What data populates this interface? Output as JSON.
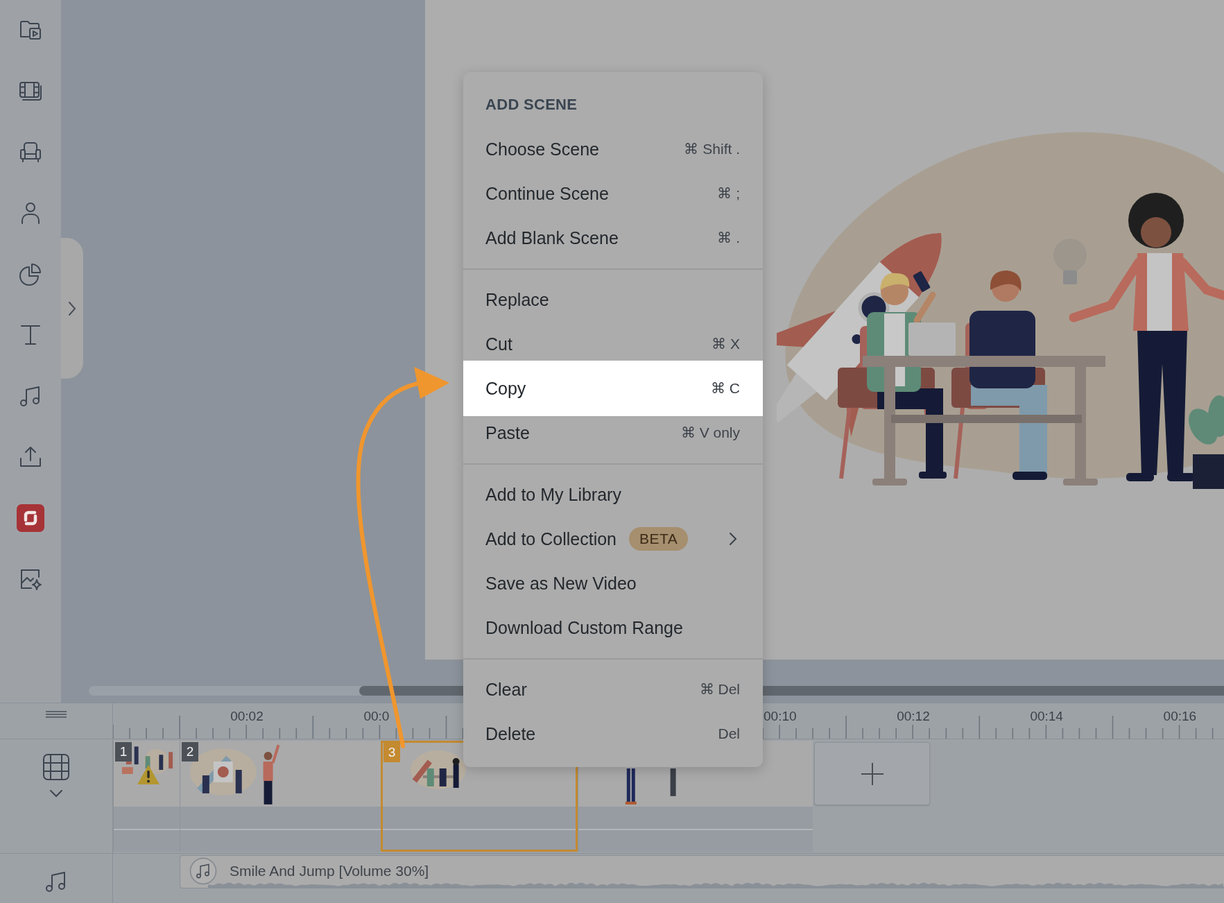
{
  "context_menu": {
    "sections": [
      {
        "header": "ADD SCENE",
        "items": [
          {
            "label": "Choose Scene",
            "shortcut": "⌘ Shift .",
            "submenu": false,
            "selected": false
          },
          {
            "label": "Continue Scene",
            "shortcut": "⌘ ;",
            "submenu": false,
            "selected": false
          },
          {
            "label": "Add Blank Scene",
            "shortcut": "⌘ .",
            "submenu": false,
            "selected": false
          }
        ]
      },
      {
        "items": [
          {
            "label": "Replace",
            "submenu": false,
            "selected": false
          },
          {
            "label": "Cut",
            "shortcut": "⌘ X",
            "submenu": false,
            "selected": false
          },
          {
            "label": "Copy",
            "shortcut": "⌘ C",
            "submenu": false,
            "selected": true
          },
          {
            "label": "Paste",
            "shortcut": "⌘ V only",
            "submenu": false,
            "selected": false
          }
        ]
      },
      {
        "items": [
          {
            "label": "Add to My Library",
            "submenu": false,
            "selected": false
          },
          {
            "label": "Add to Collection",
            "badge": "BETA",
            "submenu": true,
            "selected": false
          },
          {
            "label": "Save as New Video",
            "submenu": false,
            "selected": false
          },
          {
            "label": "Download Custom Range",
            "submenu": false,
            "selected": false
          }
        ]
      },
      {
        "items": [
          {
            "label": "Clear",
            "shortcut": "⌘ Del",
            "submenu": false,
            "selected": false
          },
          {
            "label": "Delete",
            "shortcut": "Del",
            "submenu": false,
            "selected": false
          }
        ]
      }
    ]
  },
  "timeline": {
    "ruler_labels": [
      "00:02",
      "00:0",
      "00:10",
      "00:12",
      "00:14",
      "00:16"
    ],
    "scenes": [
      {
        "number": "1",
        "warning": true,
        "selected": false
      },
      {
        "number": "2",
        "warning": false,
        "selected": false
      },
      {
        "number": "3",
        "warning": false,
        "selected": true
      },
      {
        "warning": false,
        "selected": false
      }
    ],
    "audio_track": {
      "title": "Smile And Jump [Volume 30%]"
    }
  }
}
